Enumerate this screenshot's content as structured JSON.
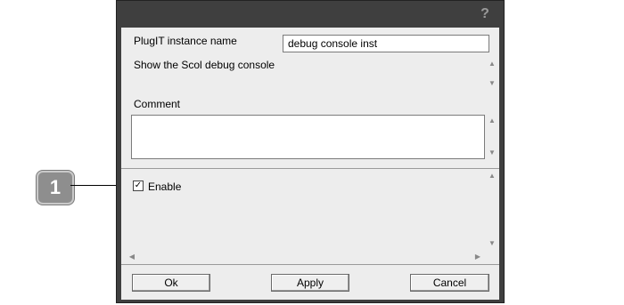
{
  "titlebar": {
    "help_icon": "?"
  },
  "form": {
    "instance_name_label": "PlugIT instance name",
    "instance_name_value": "debug console inst",
    "description": "Show the Scol debug console",
    "comment_label": "Comment",
    "comment_value": "",
    "enable_label": "Enable",
    "enable_checked": true
  },
  "buttons": {
    "ok": "Ok",
    "apply": "Apply",
    "cancel": "Cancel"
  },
  "annotation": {
    "number": "1"
  }
}
